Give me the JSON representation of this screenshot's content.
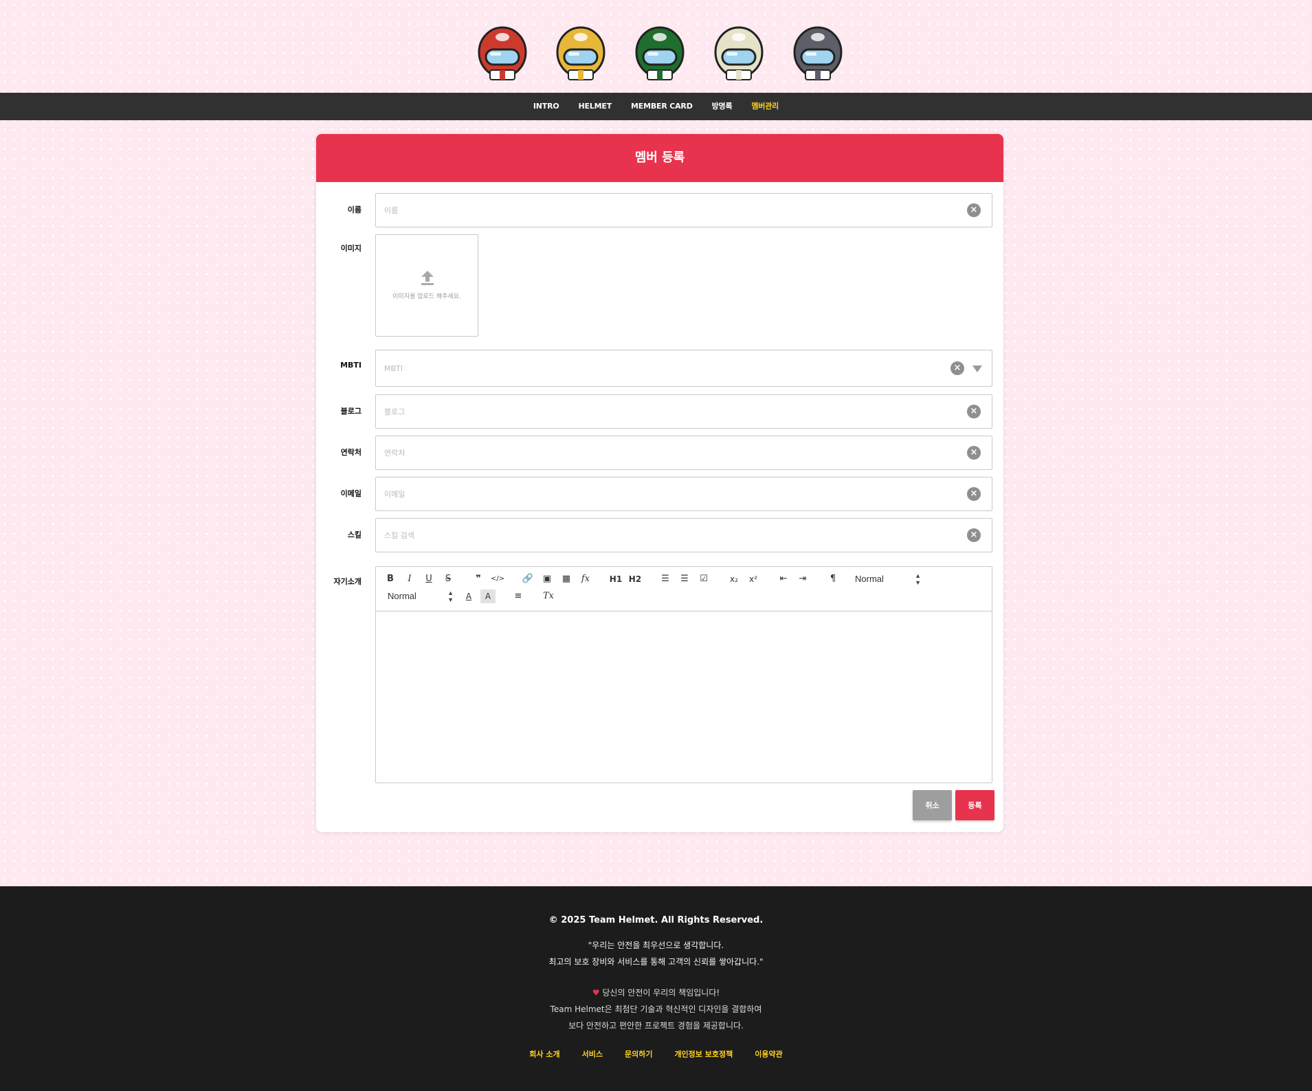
{
  "nav": {
    "items": [
      {
        "label": "INTRO"
      },
      {
        "label": "HELMET"
      },
      {
        "label": "MEMBER CARD"
      },
      {
        "label": "방명록"
      },
      {
        "label": "멤버관리"
      }
    ]
  },
  "helmets": [
    {
      "name": "red-helmet-icon",
      "color": "#cc3a2e"
    },
    {
      "name": "yellow-helmet-icon",
      "color": "#e8b73a"
    },
    {
      "name": "green-helmet-icon",
      "color": "#1f6e2e"
    },
    {
      "name": "cream-helmet-icon",
      "color": "#e6e2c8"
    },
    {
      "name": "gray-helmet-icon",
      "color": "#5c5e68"
    }
  ],
  "form": {
    "title": "멤버 등록",
    "name": {
      "label": "이름",
      "placeholder": "이름"
    },
    "image": {
      "label": "이미지",
      "upload_text": "이미지를 업로드 해주세요."
    },
    "mbti": {
      "label": "MBTI",
      "placeholder": "MBTI"
    },
    "blog": {
      "label": "블로그",
      "placeholder": "블로그"
    },
    "contact": {
      "label": "연락처",
      "placeholder": "연락처"
    },
    "email": {
      "label": "이메일",
      "placeholder": "이메일"
    },
    "skill": {
      "label": "스킬",
      "placeholder": "스킬 검색"
    },
    "intro": {
      "label": "자기소개"
    },
    "editor": {
      "size_select": "Normal",
      "header_select": "Normal"
    },
    "cancel_label": "취소",
    "submit_label": "등록"
  },
  "colors": {
    "accent": "#e8334e",
    "nav_active": "#ffd21f",
    "nav_bg": "#313131",
    "footer_bg": "#1c1c1c"
  },
  "footer": {
    "copyright": "© 2025 Team Helmet. All Rights Reserved.",
    "quote_line1": "\"우리는 안전을 최우선으로 생각합니다.",
    "quote_line2": "최고의 보호 장비와 서비스를 통해 고객의 신뢰를 쌓아갑니다.\"",
    "promo_line1": "당신의 안전이 우리의 책임입니다!",
    "promo_line2": "Team Helmet은 최첨단 기술과 혁신적인 디자인을 결합하여",
    "promo_line3": "보다 안전하고 편안한 프로젝트 경험을 제공합니다.",
    "links": [
      {
        "label": "회사 소개"
      },
      {
        "label": "서비스"
      },
      {
        "label": "문의하기"
      },
      {
        "label": "개인정보 보호정책"
      },
      {
        "label": "이용약관"
      }
    ]
  }
}
